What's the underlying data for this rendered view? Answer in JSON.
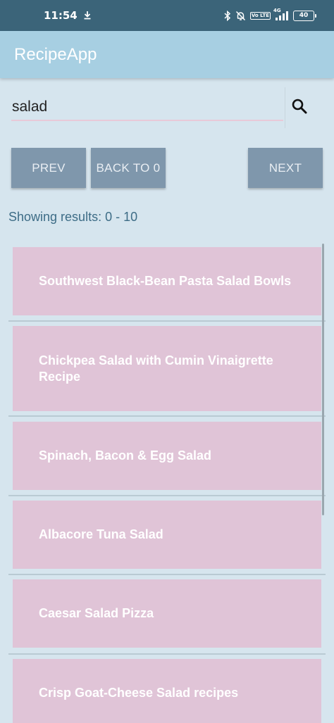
{
  "status_bar": {
    "time": "11:54",
    "network_label": "4G",
    "lte_label": "Vo LTE",
    "battery": "40"
  },
  "app_bar": {
    "title": "RecipeApp"
  },
  "search": {
    "value": "salad",
    "icon": "search-icon"
  },
  "buttons": {
    "prev_label": "PREV",
    "back_label": "BACK TO 0",
    "next_label": "NEXT"
  },
  "results_info": "Showing results: 0 - 10",
  "recipes": [
    "Southwest Black-Bean Pasta Salad Bowls",
    "Chickpea Salad with Cumin Vinaigrette Recipe",
    "Spinach, Bacon & Egg Salad",
    "Albacore Tuna Salad",
    "Caesar Salad Pizza",
    "Crisp Goat-Cheese Salad recipes"
  ],
  "colors": {
    "status_bar": "#3b6479",
    "app_bar": "#a7cfe2",
    "background": "#d6e5ee",
    "button": "#7f97ac",
    "list_item": "#e0c4d7",
    "results_text": "#3d6c86"
  }
}
